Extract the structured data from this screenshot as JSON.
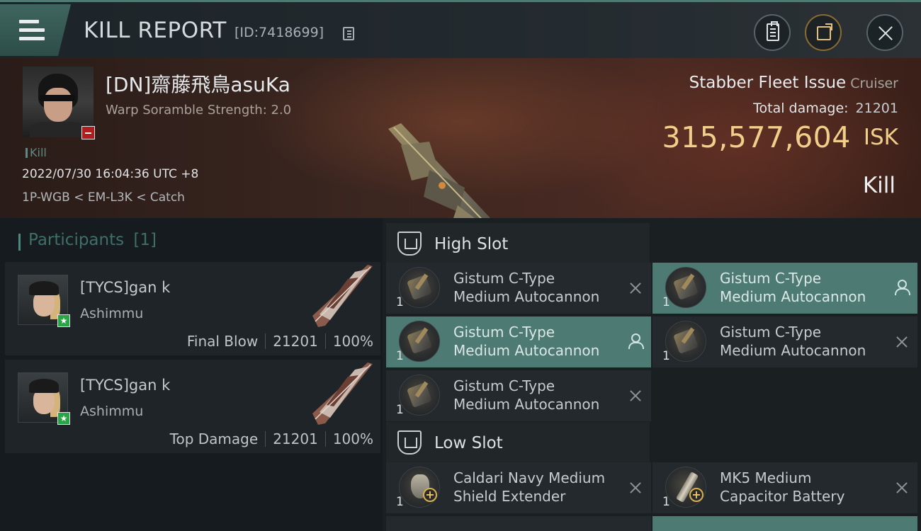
{
  "header": {
    "title": "KILL REPORT",
    "report_id": "[ID:7418699]",
    "icons": [
      "menu-icon",
      "copy-icon",
      "clipboard-icon",
      "share-icon",
      "close-icon"
    ]
  },
  "victim": {
    "name": "[DN]齋藤飛鳥asuKa",
    "warp_scramble": "Warp Soramble Strength: 2.0",
    "kill_tag": "Kill",
    "datetime": "2022/07/30 16:04:36 UTC +8",
    "location": "1P-WGB < EM-L3K < Catch"
  },
  "ship": {
    "name": "Stabber Fleet Issue",
    "class": "Cruiser",
    "total_damage_label": "Total damage:",
    "total_damage": "21201",
    "isk_value": "315,577,604",
    "isk_unit": "ISK",
    "result": "Kill"
  },
  "participants": {
    "title": "Participants",
    "count": "[1]",
    "cards": [
      {
        "name": "[TYCS]gan k",
        "corp": "Ashimmu",
        "role": "Final Blow",
        "damage": "21201",
        "percent": "100%"
      },
      {
        "name": "[TYCS]gan k",
        "corp": "Ashimmu",
        "role": "Top Damage",
        "damage": "21201",
        "percent": "100%"
      }
    ]
  },
  "fitting": {
    "high_label": "High Slot",
    "low_label": "Low Slot",
    "high": [
      {
        "line1": "Gistum C-Type",
        "line2": "Medium Autocannon",
        "qty": "1",
        "state": "destroyed"
      },
      {
        "line1": "Gistum C-Type",
        "line2": "Medium Autocannon",
        "qty": "1",
        "state": "dropped"
      },
      {
        "line1": "Gistum C-Type",
        "line2": "Medium Autocannon",
        "qty": "1",
        "state": "dropped"
      },
      {
        "line1": "Gistum C-Type",
        "line2": "Medium Autocannon",
        "qty": "1",
        "state": "destroyed"
      },
      {
        "line1": "Gistum C-Type",
        "line2": "Medium Autocannon",
        "qty": "1",
        "state": "destroyed"
      }
    ],
    "low": [
      {
        "line1": "Caldari Navy Medium",
        "line2": "Shield Extender",
        "qty": "1",
        "state": "destroyed"
      },
      {
        "line1": "MK5 Medium",
        "line2": "Capacitor Battery",
        "qty": "1",
        "state": "destroyed"
      }
    ]
  },
  "colors": {
    "accent_teal": "#4d7b74",
    "isk_gold": "#f1cf8b",
    "status_red": "#b31c1c",
    "status_green": "#29a548"
  }
}
